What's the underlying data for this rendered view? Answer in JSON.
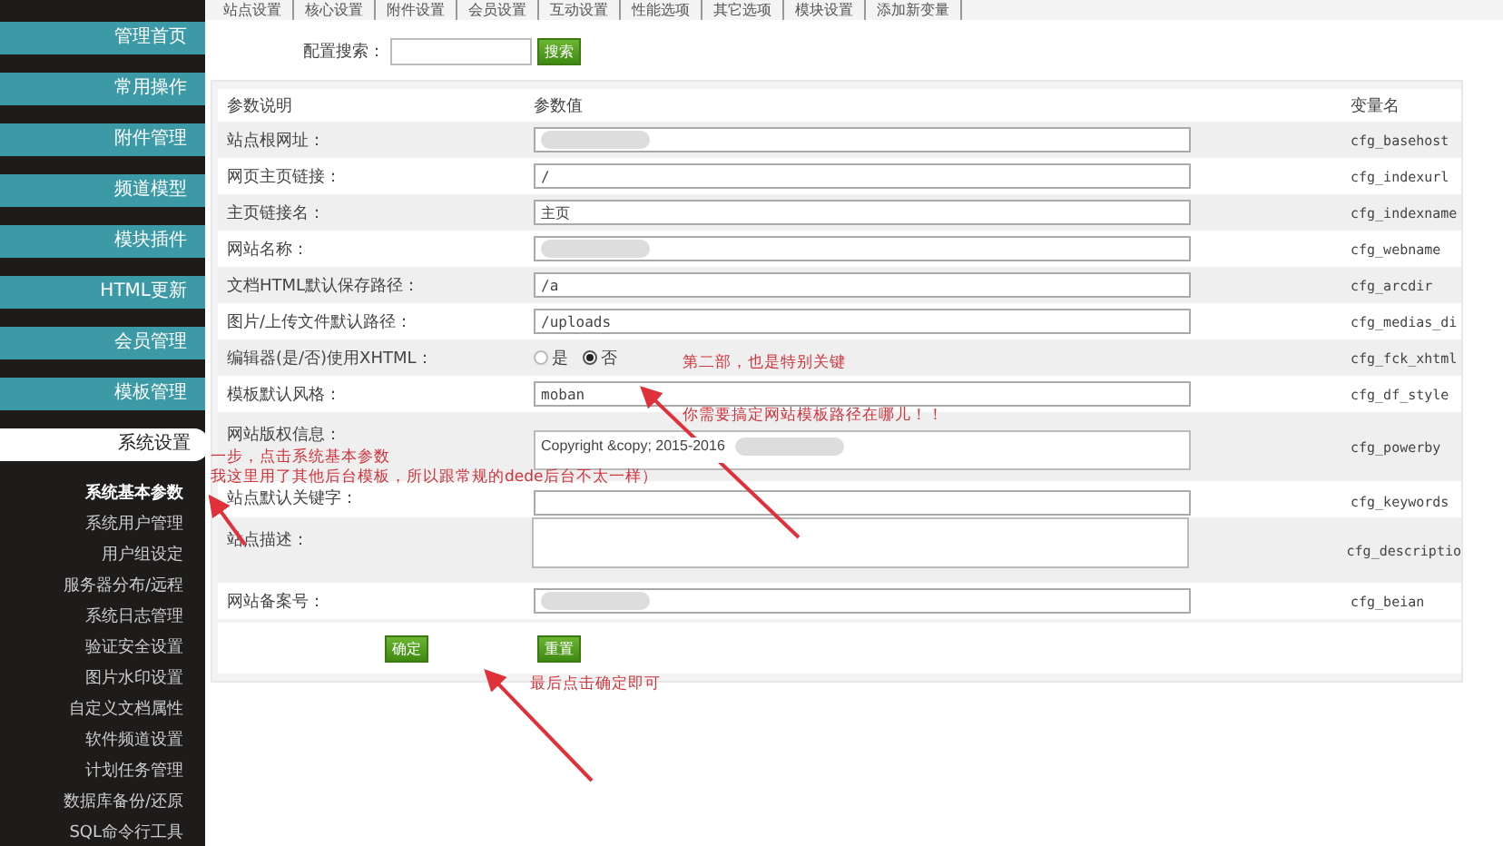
{
  "top_tabs": [
    "站点设置",
    "核心设置",
    "附件设置",
    "会员设置",
    "互动设置",
    "性能选项",
    "其它选项",
    "模块设置",
    "添加新变量"
  ],
  "sidebar": {
    "menus": [
      {
        "label": "管理首页",
        "selected": false
      },
      {
        "label": "常用操作",
        "selected": false
      },
      {
        "label": "附件管理",
        "selected": false
      },
      {
        "label": "频道模型",
        "selected": false
      },
      {
        "label": "模块插件",
        "selected": false
      },
      {
        "label": "HTML更新",
        "selected": false
      },
      {
        "label": "会员管理",
        "selected": false
      },
      {
        "label": "模板管理",
        "selected": false
      },
      {
        "label": "系统设置",
        "selected": true
      }
    ],
    "submenu": [
      {
        "label": "系统基本参数",
        "selected": true
      },
      {
        "label": "系统用户管理",
        "selected": false
      },
      {
        "label": "用户组设定",
        "selected": false
      },
      {
        "label": "服务器分布/远程",
        "selected": false
      },
      {
        "label": "系统日志管理",
        "selected": false
      },
      {
        "label": "验证安全设置",
        "selected": false
      },
      {
        "label": "图片水印设置",
        "selected": false
      },
      {
        "label": "自定义文档属性",
        "selected": false
      },
      {
        "label": "软件频道设置",
        "selected": false
      },
      {
        "label": "计划任务管理",
        "selected": false
      },
      {
        "label": "数据库备份/还原",
        "selected": false
      },
      {
        "label": "SQL命令行工具",
        "selected": false
      }
    ]
  },
  "search": {
    "label": "配置搜索：",
    "button": "搜索"
  },
  "table": {
    "columns": [
      "参数说明",
      "参数值",
      "变量名"
    ],
    "rows": [
      {
        "kind": "text",
        "label": "站点根网址：",
        "value": "",
        "redacted": true,
        "variable": "cfg_basehost"
      },
      {
        "kind": "text",
        "label": "网页主页链接：",
        "value": "/",
        "redacted": false,
        "variable": "cfg_indexurl"
      },
      {
        "kind": "text",
        "label": "主页链接名：",
        "value": "主页",
        "redacted": false,
        "variable": "cfg_indexname"
      },
      {
        "kind": "text",
        "label": "网站名称：",
        "value": "",
        "redacted": true,
        "variable": "cfg_webname"
      },
      {
        "kind": "text",
        "label": "文档HTML默认保存路径：",
        "value": "/a",
        "redacted": false,
        "variable": "cfg_arcdir"
      },
      {
        "kind": "text",
        "label": "图片/上传文件默认路径：",
        "value": "/uploads",
        "redacted": false,
        "variable": "cfg_medias_di"
      },
      {
        "kind": "radio",
        "label": "编辑器(是/否)使用XHTML：",
        "options": [
          {
            "label": "是",
            "selected": false
          },
          {
            "label": "否",
            "selected": true
          }
        ],
        "variable": "cfg_fck_xhtml"
      },
      {
        "kind": "text",
        "label": "模板默认风格：",
        "value": "moban",
        "redacted": false,
        "variable": "cfg_df_style"
      },
      {
        "kind": "textarea",
        "label": "网站版权信息：",
        "value": "Copyright &copy; 2015-2016",
        "redacted": true,
        "variable": "cfg_powerby"
      },
      {
        "kind": "text",
        "label": "站点默认关键字：",
        "value": "",
        "redacted": false,
        "variable": "cfg_keywords"
      },
      {
        "kind": "textarea",
        "label": "站点描述：",
        "value": "",
        "redacted": false,
        "variable": "cfg_descriptio"
      },
      {
        "kind": "text",
        "label": "网站备案号：",
        "value": "",
        "redacted": true,
        "variable": "cfg_beian"
      }
    ]
  },
  "buttons": [
    "确定",
    "重置"
  ],
  "annotations": [
    "一步，点击系统基本参数",
    "我这里用了其他后台模板，所以跟常规的dede后台不太一样）",
    "第二部，也是特别关键",
    "你需要搞定网站模板路径在哪儿！！",
    "最后点击确定即可"
  ]
}
